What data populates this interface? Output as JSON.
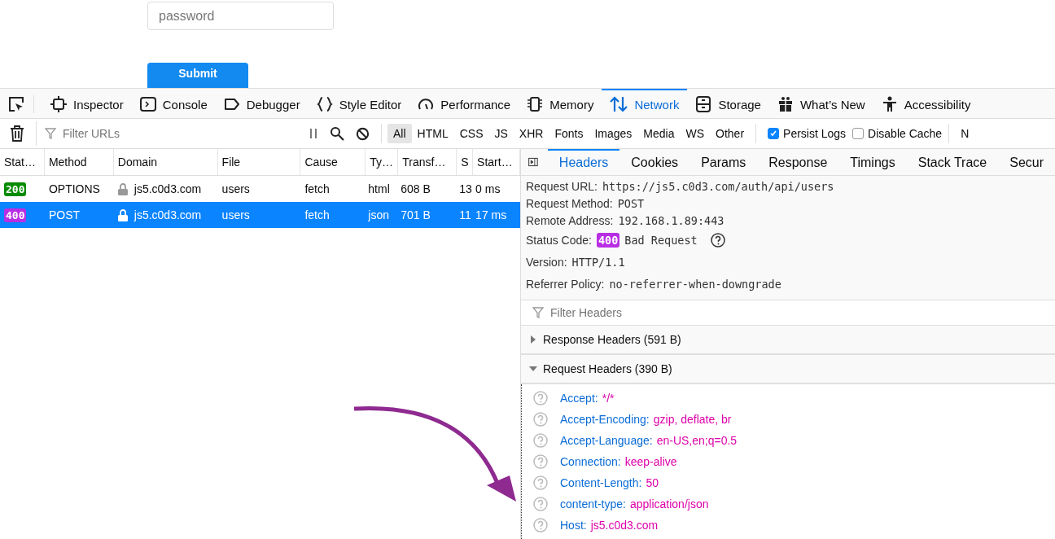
{
  "page": {
    "password_placeholder": "password",
    "submit": "Submit"
  },
  "devtools_tabs": [
    {
      "label": "Inspector",
      "kind": "inspector",
      "selected": false
    },
    {
      "label": "Console",
      "kind": "console",
      "selected": false
    },
    {
      "label": "Debugger",
      "kind": "debugger",
      "selected": false
    },
    {
      "label": "Style Editor",
      "kind": "style",
      "selected": false
    },
    {
      "label": "Performance",
      "kind": "performance",
      "selected": false
    },
    {
      "label": "Memory",
      "kind": "memory",
      "selected": false
    },
    {
      "label": "Network",
      "kind": "network",
      "selected": true
    },
    {
      "label": "Storage",
      "kind": "storage",
      "selected": false
    },
    {
      "label": "What’s New",
      "kind": "whatsnew",
      "selected": false
    },
    {
      "label": "Accessibility",
      "kind": "accessibility",
      "selected": false
    }
  ],
  "toolbar": {
    "filter_placeholder": "Filter URLs",
    "type_filters": [
      {
        "label": "All",
        "selected": true
      },
      {
        "label": "HTML",
        "selected": false
      },
      {
        "label": "CSS",
        "selected": false
      },
      {
        "label": "JS",
        "selected": false
      },
      {
        "label": "XHR",
        "selected": false
      },
      {
        "label": "Fonts",
        "selected": false
      },
      {
        "label": "Images",
        "selected": false
      },
      {
        "label": "Media",
        "selected": false
      },
      {
        "label": "WS",
        "selected": false
      },
      {
        "label": "Other",
        "selected": false
      }
    ],
    "persist_logs": {
      "label": "Persist Logs",
      "checked": true
    },
    "disable_cache": {
      "label": "Disable Cache",
      "checked": false
    },
    "column_cut": "N"
  },
  "requests": {
    "columns": [
      "Stat…",
      "Method",
      "Domain",
      "File",
      "Cause",
      "Ty…",
      "Transf…",
      "S",
      "Start…"
    ],
    "rows": [
      {
        "status": "200",
        "color": "#058b00",
        "method": "OPTIONS",
        "domain": "js5.c0d3.com",
        "file": "users",
        "cause": "fetch",
        "type": "html",
        "transferred": "608 B",
        "size": "13",
        "start": "0 ms",
        "selected": false
      },
      {
        "status": "400",
        "color": "#b82ee5",
        "method": "POST",
        "domain": "js5.c0d3.com",
        "file": "users",
        "cause": "fetch",
        "type": "json",
        "transferred": "701 B",
        "size": "11",
        "start": "17 ms",
        "selected": true
      }
    ]
  },
  "details": {
    "tabs": [
      {
        "label": "Headers",
        "selected": true
      },
      {
        "label": "Cookies",
        "selected": false
      },
      {
        "label": "Params",
        "selected": false
      },
      {
        "label": "Response",
        "selected": false
      },
      {
        "label": "Timings",
        "selected": false
      },
      {
        "label": "Stack Trace",
        "selected": false
      },
      {
        "label": "Secur",
        "selected": false
      }
    ],
    "summary": [
      {
        "label": "Request URL:",
        "value": "https://js5.c0d3.com/auth/api/users"
      },
      {
        "label": "Request Method:",
        "value": "POST"
      },
      {
        "label": "Remote Address:",
        "value": "192.168.1.89:443"
      }
    ],
    "status_code": {
      "label": "Status Code:",
      "badge": "400",
      "color": "#b82ee5",
      "text": "Bad Request"
    },
    "summary_more": [
      {
        "label": "Version:",
        "value": "HTTP/1.1"
      },
      {
        "label": "Referrer Policy:",
        "value": "no-referrer-when-downgrade"
      }
    ],
    "filter_placeholder": "Filter Headers",
    "sections": [
      {
        "title": "Response Headers (591 B)",
        "expanded": false
      },
      {
        "title": "Request Headers (390 B)",
        "expanded": true
      }
    ],
    "request_headers": [
      {
        "name": "Accept:",
        "value": "*/*"
      },
      {
        "name": "Accept-Encoding:",
        "value": "gzip, deflate, br"
      },
      {
        "name": "Accept-Language:",
        "value": "en-US,en;q=0.5"
      },
      {
        "name": "Connection:",
        "value": "keep-alive"
      },
      {
        "name": "Content-Length:",
        "value": "50"
      },
      {
        "name": "content-type:",
        "value": "application/json"
      },
      {
        "name": "Host:",
        "value": "js5.c0d3.com"
      }
    ]
  }
}
